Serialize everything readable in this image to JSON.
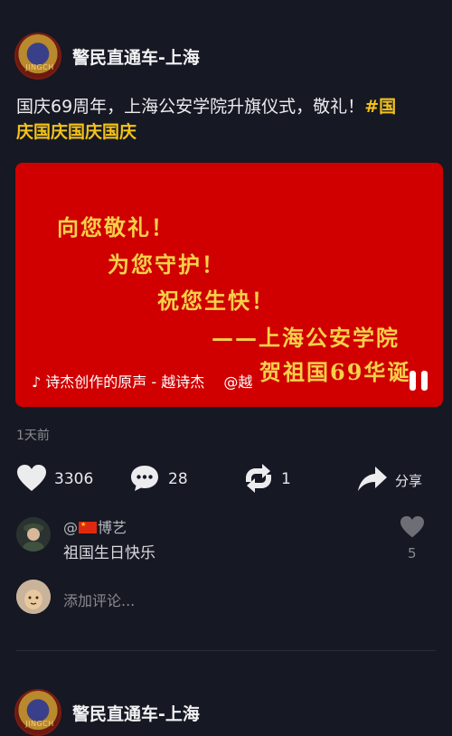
{
  "post": {
    "author": "警民直通车-上海",
    "text": "国庆69周年，上海公安学院升旗仪式，敬礼！",
    "hashtag_line1": "#国",
    "hashtag_line2": "庆国庆国庆国庆",
    "time": "1天前"
  },
  "video": {
    "poem_lines": [
      "向您敬礼！",
      "为您守护！",
      "祝您生快！",
      "——上海公安学院",
      "贺祖国69华诞"
    ],
    "music": "♪ 诗杰创作的原声 - 越诗杰",
    "mention": "@越"
  },
  "actions": {
    "likes": "3306",
    "comments": "28",
    "reposts": "1",
    "share_label": "分享"
  },
  "comment": {
    "user_prefix": "@",
    "user_name": "博艺",
    "text": "祖国生日快乐",
    "likes": "5"
  },
  "add_comment_placeholder": "添加评论...",
  "next_post": {
    "author": "警民直通车-上海"
  },
  "avatar_badge_text": "JINGCH"
}
